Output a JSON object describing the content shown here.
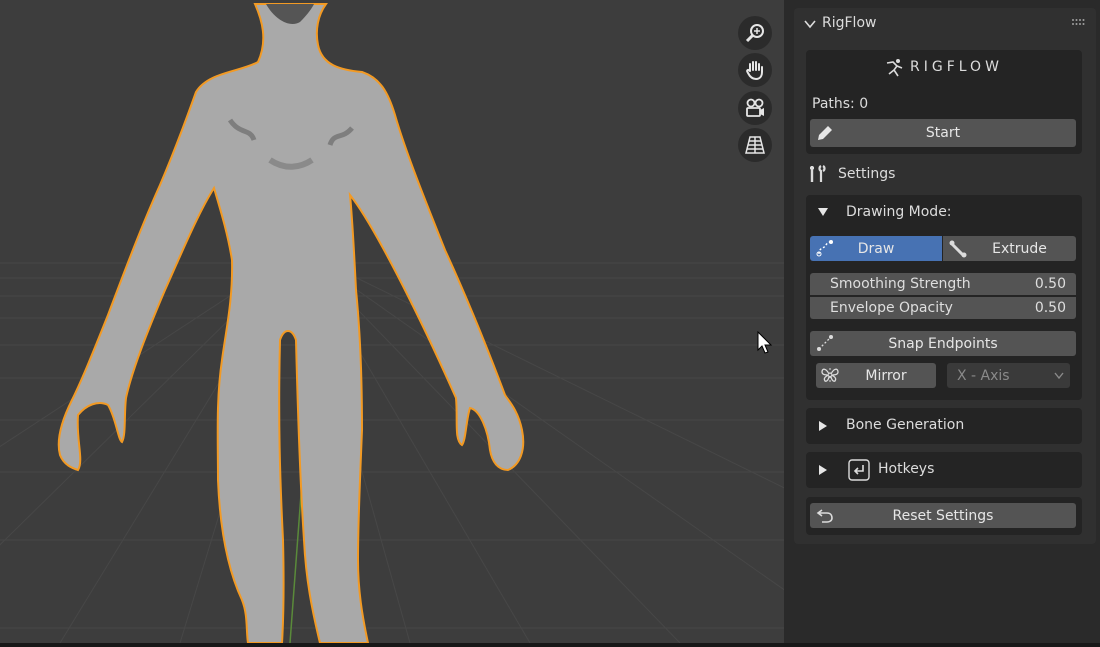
{
  "panel": {
    "title": "RigFlow",
    "logo_text": "RIGFLOW",
    "paths_label": "Paths: 0",
    "start_label": "Start",
    "settings_label": "Settings",
    "drawing_mode": {
      "label": "Drawing Mode:",
      "draw_label": "Draw",
      "extrude_label": "Extrude",
      "selected": "Draw",
      "smoothing_label": "Smoothing Strength",
      "smoothing_value": "0.50",
      "opacity_label": "Envelope Opacity",
      "opacity_value": "0.50",
      "snap_label": "Snap Endpoints",
      "mirror_label": "Mirror",
      "axis_value": "X - Axis"
    },
    "bone_generation_label": "Bone Generation",
    "hotkeys_label": "Hotkeys",
    "reset_label": "Reset Settings"
  },
  "viewport": {
    "nav_icons": [
      "zoom-icon",
      "hand-pan-icon",
      "camera-icon",
      "grid-perspective-icon"
    ]
  },
  "colors": {
    "accent": "#4772b3",
    "outline": "#f29a24",
    "viewport_bg": "#3d3d3d",
    "panel_bg": "#303030"
  }
}
